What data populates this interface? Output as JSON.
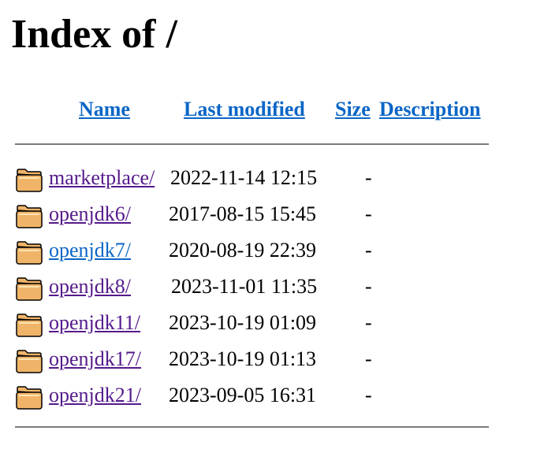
{
  "page": {
    "title": "Index of /"
  },
  "table": {
    "headers": {
      "name": "Name",
      "last_modified": "Last modified",
      "size": "Size",
      "description": "Description"
    },
    "rows": [
      {
        "name": "marketplace/",
        "modified": "2022-11-14 12:15",
        "size": "-",
        "description": "",
        "icon": "folder-icon",
        "visited": true
      },
      {
        "name": "openjdk6/",
        "modified": "2017-08-15 15:45",
        "size": "-",
        "description": "",
        "icon": "folder-icon",
        "visited": true
      },
      {
        "name": "openjdk7/",
        "modified": "2020-08-19 22:39",
        "size": "-",
        "description": "",
        "icon": "folder-icon",
        "visited": false
      },
      {
        "name": "openjdk8/",
        "modified": "2023-11-01 11:35",
        "size": "-",
        "description": "",
        "icon": "folder-icon",
        "visited": true
      },
      {
        "name": "openjdk11/",
        "modified": "2023-10-19 01:09",
        "size": "-",
        "description": "",
        "icon": "folder-icon",
        "visited": true
      },
      {
        "name": "openjdk17/",
        "modified": "2023-10-19 01:13",
        "size": "-",
        "description": "",
        "icon": "folder-icon",
        "visited": true
      },
      {
        "name": "openjdk21/",
        "modified": "2023-09-05 16:31",
        "size": "-",
        "description": "",
        "icon": "folder-icon",
        "visited": true
      }
    ]
  },
  "colors": {
    "link": "#0b66c6",
    "visited_link": "#551a8b",
    "rule": "#7a7a7a",
    "folder_fill": "#f0b469",
    "folder_outline": "#000000"
  }
}
